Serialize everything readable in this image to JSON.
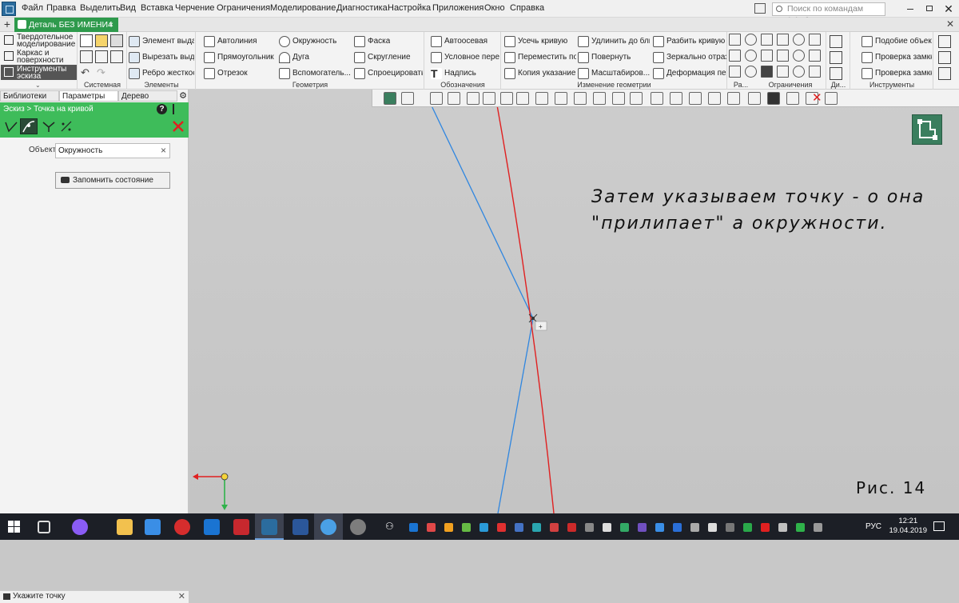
{
  "menu": [
    "Файл",
    "Правка",
    "Выделить",
    "Вид",
    "Вставка",
    "Черчение",
    "Ограничения",
    "Моделирование",
    "Диагностика",
    "Настройка",
    "Приложения",
    "Окно",
    "Справка"
  ],
  "search_placeholder": "Поиск по командам (Alt+/)",
  "doc_tab": "Деталь БЕЗ ИМЕНИ4",
  "side_modes": [
    "Твердотельное моделирование",
    "Каркас и поверхности",
    "Инструменты эскиза"
  ],
  "ribbon": {
    "elements": [
      "Элемент выдавливания",
      "Вырезать выдавливанием",
      "Ребро жесткости"
    ],
    "geometry": [
      "Автолиния",
      "Окружность",
      "Фаска",
      "Прямоугольник",
      "Дуга",
      "Скругление",
      "Отрезок",
      "Вспомогатель... прямая",
      "Спроецировать объект"
    ],
    "designations": [
      "Автоосевая",
      "Условное пересечение",
      "Надпись"
    ],
    "edit_geometry": [
      "Усечь кривую",
      "Удлинить до ближайшего о...",
      "Разбить кривую",
      "Переместить по координатам",
      "Повернуть",
      "Зеркально отразить",
      "Копия указанием",
      "Масштабиров...",
      "Деформация перемещением"
    ],
    "tools": [
      "Подобие объекта",
      "Проверка замкнутос...",
      "Проверка замкнутос..."
    ],
    "group_labels": [
      "Системная",
      "Элементы",
      "Геометрия",
      "Обозначения",
      "Изменение геометрии",
      "Ра...",
      "Ограничения",
      "Ди...",
      "Инструменты"
    ]
  },
  "panel": {
    "tabs": [
      "Библиотеки",
      "Параметры",
      "Дерево"
    ],
    "breadcrumb": "Эскиз > Точка на кривой",
    "object_label": "Объект:",
    "object_value": "Окружность",
    "save_state": "Запомнить состояние",
    "status": "Укажите точку"
  },
  "canvas": {
    "annotation_line1": "Затем указываем точку - о она",
    "annotation_line2": "\"прилипает\" а окружности.",
    "caption": "Рис. 14"
  },
  "taskbar": {
    "lang": "РУС",
    "time": "12:21",
    "date": "19.04.2019"
  },
  "colors": {
    "accent_green": "#3ebc5a",
    "doc_tab_green": "#2e9a4c",
    "red_curve": "#e02020",
    "blue_line": "#2f86e0"
  }
}
